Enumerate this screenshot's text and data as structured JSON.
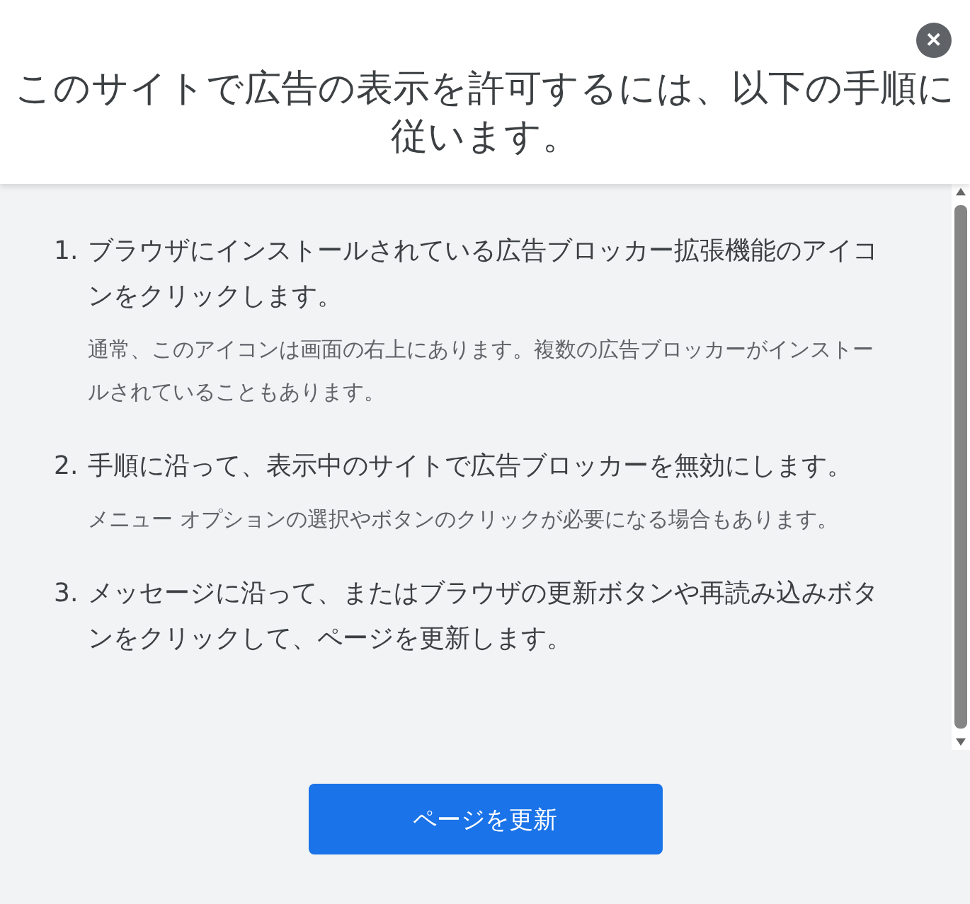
{
  "dialog": {
    "title": "このサイトで広告の表示を許可するには、以下の手順に従います。",
    "close": "✕"
  },
  "steps": [
    {
      "number": "1.",
      "text": "ブラウザにインストールされている広告ブロッカー拡張機能のアイコンをクリックします。",
      "note": "通常、このアイコンは画面の右上にあります。複数の広告ブロッカーがインストールされていることもあります。"
    },
    {
      "number": "2.",
      "text": "手順に沿って、表示中のサイトで広告ブロッカーを無効にします。",
      "note": "メニュー オプションの選択やボタンのクリックが必要になる場合もあります。"
    },
    {
      "number": "3.",
      "text": "メッセージに沿って、またはブラウザの更新ボタンや再読み込みボタンをクリックして、ページを更新します。"
    }
  ],
  "button": "ページを更新"
}
